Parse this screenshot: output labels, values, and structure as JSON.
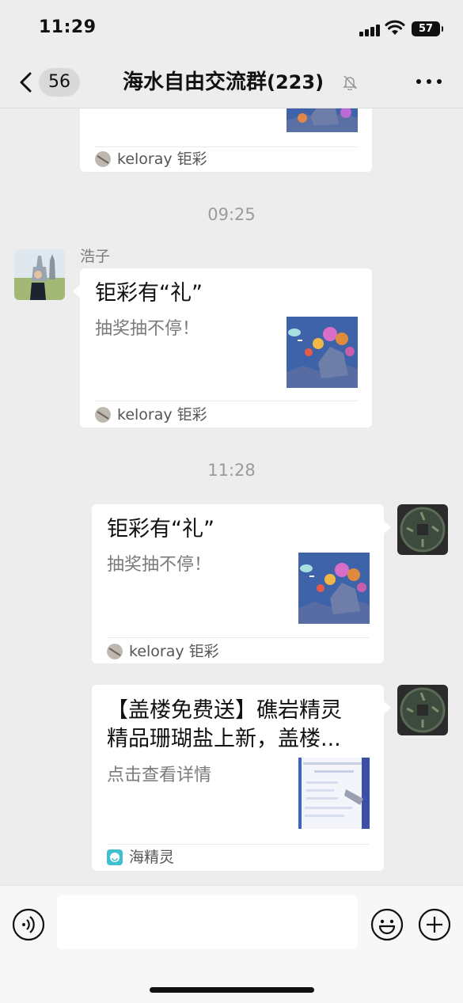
{
  "status_bar": {
    "time": "11:29",
    "battery": "57"
  },
  "nav": {
    "unread_count": "56",
    "title": "海水自由交流群",
    "member_count": "(223)"
  },
  "messages": {
    "card0": {
      "source": "keloray 钜彩"
    },
    "ts1": "09:25",
    "sender1": "浩子",
    "card1": {
      "title": "钜彩有“礼”",
      "desc": "抽奖抽不停！",
      "source": "keloray 钜彩"
    },
    "ts2": "11:28",
    "card2": {
      "title": "钜彩有“礼”",
      "desc": "抽奖抽不停！",
      "source": "keloray 钜彩"
    },
    "card3": {
      "title_line1": "【盖楼免费送】礁岩精灵",
      "title_line2": "精品珊瑚盐上新，盖楼...",
      "desc": "点击查看详情",
      "source": "海精灵"
    }
  },
  "input": {
    "placeholder": ""
  },
  "icons": {
    "back": "chevron-left-icon",
    "mute": "bell-off-icon",
    "more": "more-icon",
    "voice": "voice-icon",
    "emoji": "emoji-icon",
    "plus": "plus-icon"
  }
}
